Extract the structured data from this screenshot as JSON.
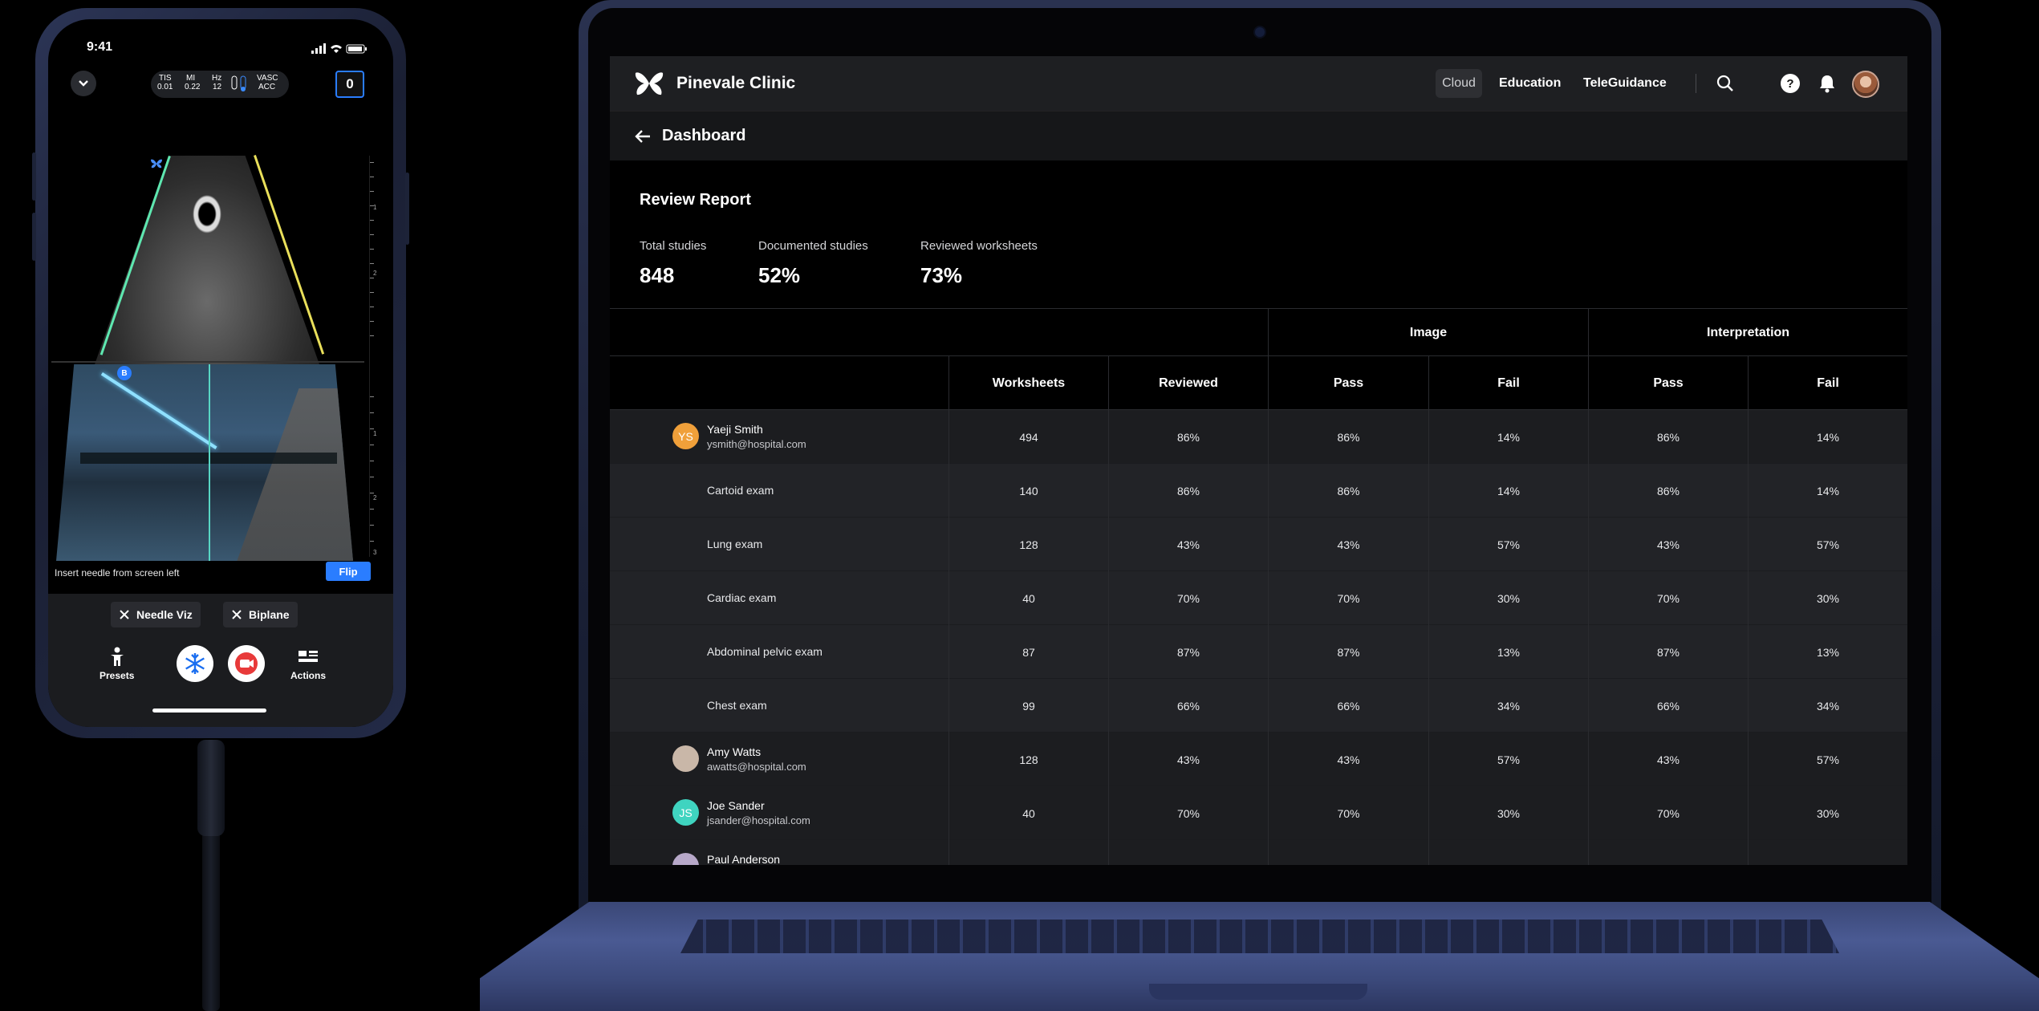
{
  "phone": {
    "time": "9:41",
    "params": {
      "tis_label": "TIS",
      "tis_value": "0.01",
      "mi_label": "MI",
      "mi_value": "0.22",
      "hz_label": "Hz",
      "hz_value": "12",
      "preset_line1": "VASC",
      "preset_line2": "ACC"
    },
    "counter": "0",
    "depth_ticks": [
      "1",
      "2",
      "1",
      "2",
      "3"
    ],
    "biplane_badge": "B",
    "instruction": "Insert needle from screen left",
    "flip_label": "Flip",
    "chips": [
      {
        "label": "Needle Viz"
      },
      {
        "label": "Biplane"
      }
    ],
    "tools": {
      "presets_label": "Presets",
      "actions_label": "Actions"
    }
  },
  "app": {
    "brand": "Pinevale Clinic",
    "nav": {
      "cloud": "Cloud",
      "education": "Education",
      "teleguidance": "TeleGuidance"
    },
    "subbar_title": "Dashboard",
    "report_title": "Review Report",
    "stats": [
      {
        "label": "Total studies",
        "value": "848"
      },
      {
        "label": "Documented studies",
        "value": "52%"
      },
      {
        "label": "Reviewed worksheets",
        "value": "73%"
      }
    ],
    "table": {
      "groups": {
        "image": "Image",
        "interpretation": "Interpretation"
      },
      "headers": {
        "worksheets": "Worksheets",
        "reviewed": "Reviewed",
        "image_pass": "Pass",
        "image_fail": "Fail",
        "interp_pass": "Pass",
        "interp_fail": "Fail"
      },
      "rows": [
        {
          "type": "user",
          "initials": "YS",
          "avatar_color": "#f0a03a",
          "name": "Yaeji Smith",
          "email": "ysmith@hospital.com",
          "values": [
            "494",
            "86%",
            "86%",
            "14%",
            "86%",
            "14%"
          ]
        },
        {
          "type": "exam",
          "name": "Cartoid exam",
          "values": [
            "140",
            "86%",
            "86%",
            "14%",
            "86%",
            "14%"
          ]
        },
        {
          "type": "exam",
          "name": "Lung exam",
          "values": [
            "128",
            "43%",
            "43%",
            "57%",
            "43%",
            "57%"
          ]
        },
        {
          "type": "exam",
          "name": "Cardiac exam",
          "values": [
            "40",
            "70%",
            "70%",
            "30%",
            "70%",
            "30%"
          ]
        },
        {
          "type": "exam",
          "name": "Abdominal pelvic exam",
          "values": [
            "87",
            "87%",
            "87%",
            "13%",
            "87%",
            "13%"
          ]
        },
        {
          "type": "exam",
          "name": "Chest exam",
          "values": [
            "99",
            "66%",
            "66%",
            "34%",
            "66%",
            "34%"
          ]
        },
        {
          "type": "user",
          "initials": "",
          "avatar_color": "#c9b7a8",
          "name": "Amy Watts",
          "email": "awatts@hospital.com",
          "values": [
            "128",
            "43%",
            "43%",
            "57%",
            "43%",
            "57%"
          ]
        },
        {
          "type": "user",
          "initials": "JS",
          "avatar_color": "#3fd4c0",
          "name": "Joe Sander",
          "email": "jsander@hospital.com",
          "values": [
            "40",
            "70%",
            "70%",
            "30%",
            "70%",
            "30%"
          ]
        },
        {
          "type": "user",
          "initials": "",
          "avatar_color": "#b7a8c9",
          "name": "Paul Anderson",
          "email": "",
          "values": [
            "",
            "",
            "",
            "",
            "",
            ""
          ]
        }
      ]
    }
  }
}
